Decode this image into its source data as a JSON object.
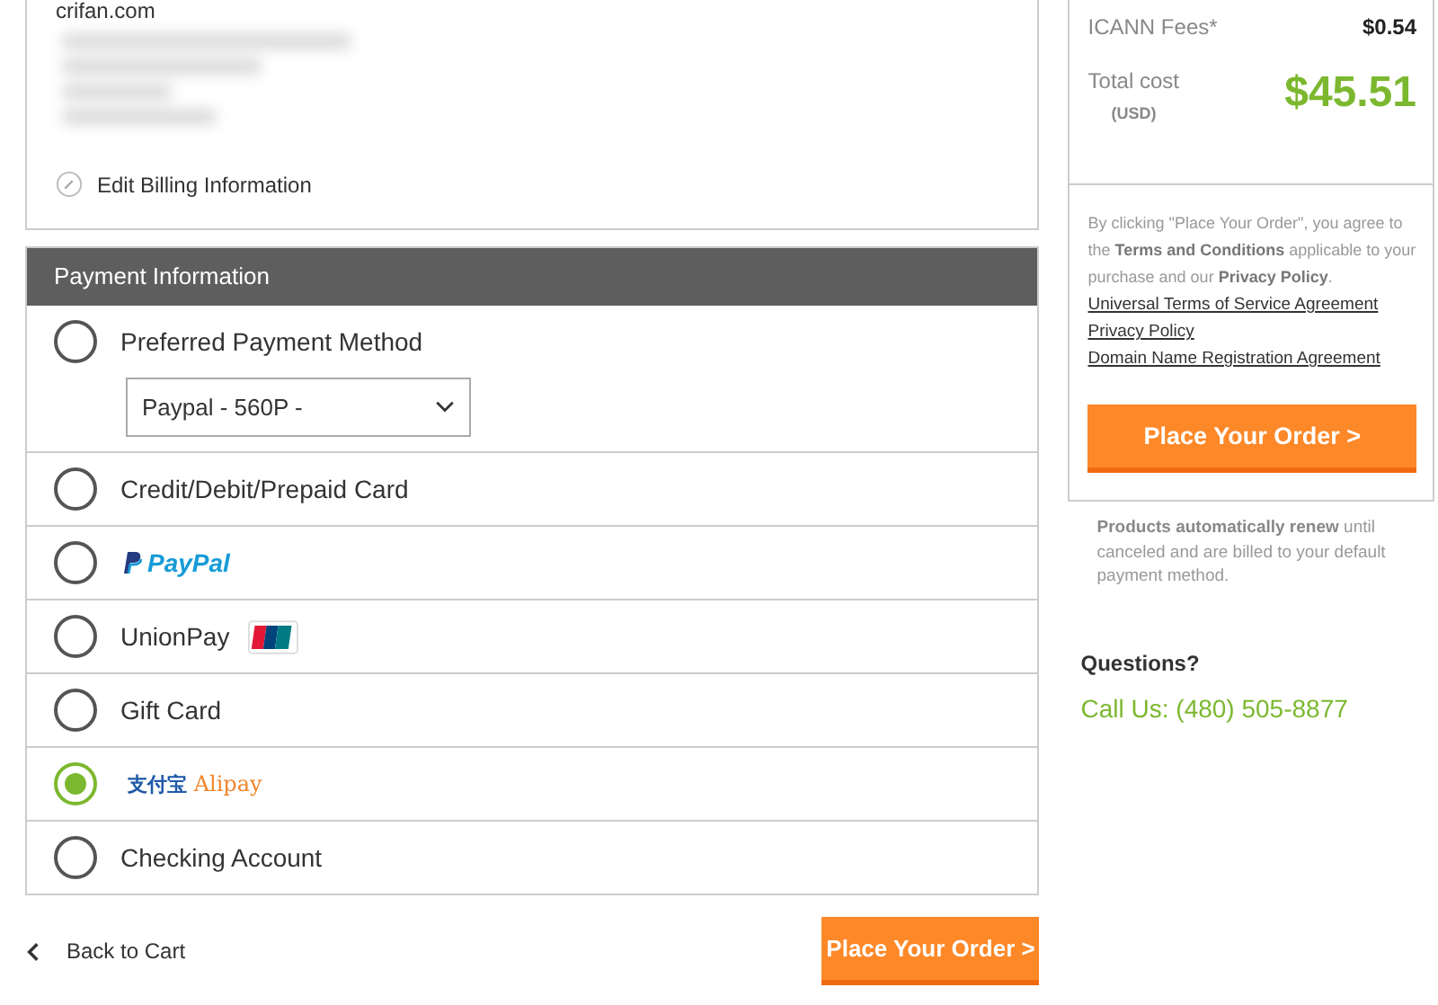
{
  "billing": {
    "domain": "crifan.com",
    "edit_link": "Edit Billing Information"
  },
  "payment": {
    "title": "Payment Information",
    "options": [
      {
        "kind": "text",
        "label": "Preferred Payment Method",
        "selected": false,
        "dropdown": {
          "value": "Paypal - 560P -"
        }
      },
      {
        "kind": "text",
        "label": "Credit/Debit/Prepaid Card",
        "selected": false
      },
      {
        "kind": "paypal",
        "label": "PayPal",
        "selected": false
      },
      {
        "kind": "unionpay",
        "label": "UnionPay",
        "selected": false
      },
      {
        "kind": "text",
        "label": "Gift Card",
        "selected": false
      },
      {
        "kind": "alipay",
        "label": "Alipay",
        "logo_text": "支付宝",
        "selected": true
      },
      {
        "kind": "text",
        "label": "Checking Account",
        "selected": false
      }
    ]
  },
  "footer": {
    "back_link": "Back to Cart",
    "order_button": "Place Your Order >"
  },
  "summary": {
    "fees_label": "ICANN Fees*",
    "fees_value": "$0.54",
    "total_label": "Total cost",
    "currency": "(USD)",
    "total_value": "$45.51",
    "terms": "By clicking \"Place Your Order\", you agree to the **Terms and Conditions** applicable to your purchase and our **Privacy Policy**.",
    "links": [
      "Universal Terms of Service Agreement",
      "Privacy Policy",
      "Domain Name Registration Agreement"
    ],
    "order_button": "Place Your Order >",
    "renew_note": "**Products automatically renew** until canceled and are billed to your default payment method.",
    "questions_title": "Questions?",
    "phone": "Call Us: (480) 505-8877"
  }
}
